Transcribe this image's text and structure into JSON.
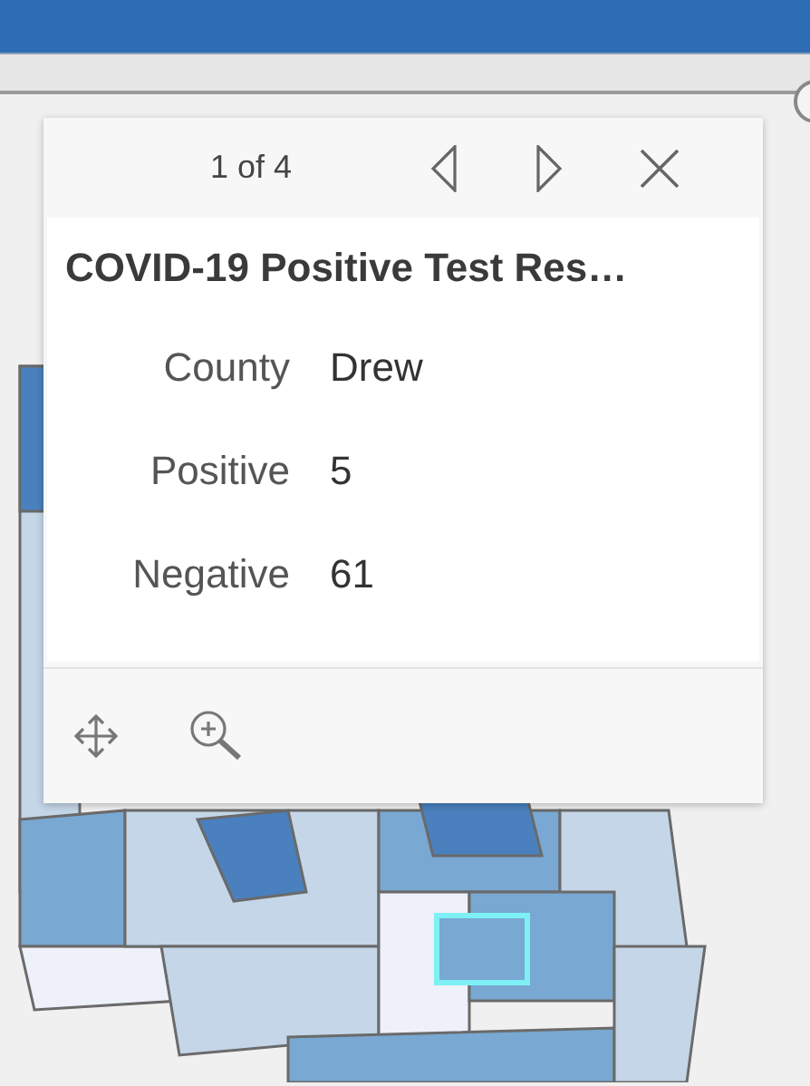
{
  "popup": {
    "pager": "1 of 4",
    "title": "COVID-19 Positive Test Res…",
    "fields": [
      {
        "label": "County",
        "value": "Drew"
      },
      {
        "label": "Positive",
        "value": "5"
      },
      {
        "label": "Negative",
        "value": "61"
      }
    ]
  }
}
